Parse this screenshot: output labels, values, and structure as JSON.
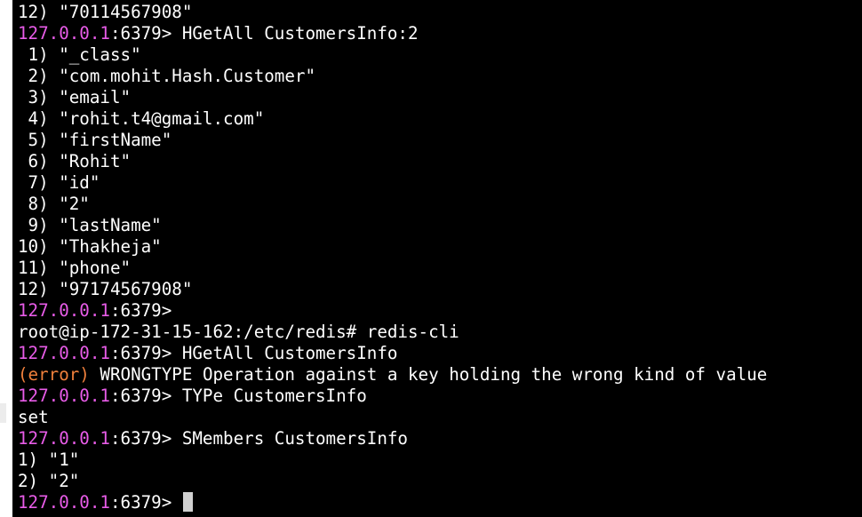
{
  "colors": {
    "background": "#000000",
    "text": "#ffffff",
    "prompt_host": "#e85ce8",
    "error": "#f0803c",
    "cursor": "#d0d0d0"
  },
  "terminal": {
    "prompt_host": "127.0.0.1",
    "prompt_rest": ":6379>",
    "lines": [
      {
        "type": "text",
        "text": "12) \"70114567908\""
      },
      {
        "type": "prompt",
        "command": " HGetAll CustomersInfo:2"
      },
      {
        "type": "text",
        "text": " 1) \"_class\""
      },
      {
        "type": "text",
        "text": " 2) \"com.mohit.Hash.Customer\""
      },
      {
        "type": "text",
        "text": " 3) \"email\""
      },
      {
        "type": "text",
        "text": " 4) \"rohit.t4@gmail.com\""
      },
      {
        "type": "text",
        "text": " 5) \"firstName\""
      },
      {
        "type": "text",
        "text": " 6) \"Rohit\""
      },
      {
        "type": "text",
        "text": " 7) \"id\""
      },
      {
        "type": "text",
        "text": " 8) \"2\""
      },
      {
        "type": "text",
        "text": " 9) \"lastName\""
      },
      {
        "type": "text",
        "text": "10) \"Thakheja\""
      },
      {
        "type": "text",
        "text": "11) \"phone\""
      },
      {
        "type": "text",
        "text": "12) \"97174567908\""
      },
      {
        "type": "prompt",
        "command": ""
      },
      {
        "type": "text",
        "text": "root@ip-172-31-15-162:/etc/redis# redis-cli"
      },
      {
        "type": "prompt",
        "command": " HGetAll CustomersInfo"
      },
      {
        "type": "error",
        "tag": "(error)",
        "text": " WRONGTYPE Operation against a key holding the wrong kind of value"
      },
      {
        "type": "prompt",
        "command": " TYPe CustomersInfo"
      },
      {
        "type": "text",
        "text": "set"
      },
      {
        "type": "prompt",
        "command": " SMembers CustomersInfo"
      },
      {
        "type": "text",
        "text": "1) \"1\""
      },
      {
        "type": "text",
        "text": "2) \"2\""
      },
      {
        "type": "prompt-active",
        "command": " "
      }
    ]
  }
}
